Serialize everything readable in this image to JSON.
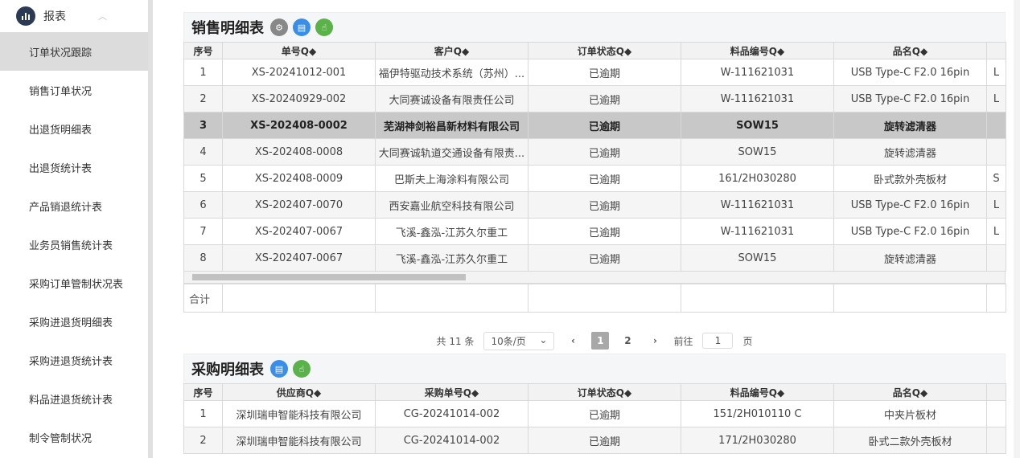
{
  "sidebar": {
    "header": {
      "label": "报表"
    },
    "items": [
      "订单状况跟踪",
      "销售订单状况",
      "出退货明细表",
      "出退货统计表",
      "产品销退统计表",
      "业务员销售统计表",
      "采购订单管制状况表",
      "采购进退货明细表",
      "采购进退货统计表",
      "料品进退货统计表",
      "制令管制状况"
    ],
    "active_index": 0
  },
  "sales": {
    "title": "销售明细表",
    "headers": [
      "序号",
      "单号Q◆",
      "客户Q◆",
      "订单状态Q◆",
      "料品编号Q◆",
      "品名Q◆"
    ],
    "rows": [
      [
        "1",
        "XS-20241012-001",
        "福伊特驱动技术系统（苏州）...",
        "已逾期",
        "W-111621031",
        "USB Type-C F2.0 16pin",
        "L"
      ],
      [
        "2",
        "XS-20240929-002",
        "大同赛诚设备有限责任公司",
        "已逾期",
        "W-111621031",
        "USB Type-C F2.0 16pin",
        "L"
      ],
      [
        "3",
        "XS-202408-0002",
        "芜湖神剑裕昌新材料有限公司",
        "已逾期",
        "SOW15",
        "旋转滤清器",
        ""
      ],
      [
        "4",
        "XS-202408-0008",
        "大同赛诚轨道交通设备有限责...",
        "已逾期",
        "SOW15",
        "旋转滤清器",
        ""
      ],
      [
        "5",
        "XS-202408-0009",
        "巴斯夫上海涂料有限公司",
        "已逾期",
        "161/2H030280",
        "卧式款外壳板材",
        "S"
      ],
      [
        "6",
        "XS-202407-0070",
        "西安嘉业航空科技有限公司",
        "已逾期",
        "W-111621031",
        "USB Type-C F2.0 16pin",
        "L"
      ],
      [
        "7",
        "XS-202407-0067",
        "飞溪-鑫泓-江苏久尔重工",
        "已逾期",
        "W-111621031",
        "USB Type-C F2.0 16pin",
        "L"
      ],
      [
        "8",
        "XS-202407-0067",
        "飞溪-鑫泓-江苏久尔重工",
        "已逾期",
        "SOW15",
        "旋转滤清器",
        ""
      ]
    ],
    "selected_row": 2,
    "total_label": "合计"
  },
  "pager": {
    "total": "共 11 条",
    "page_size": "10条/页",
    "prev": "‹",
    "pages": [
      "1",
      "2"
    ],
    "next": "›",
    "goto_prefix": "前往",
    "goto_value": "1",
    "goto_suffix": "页"
  },
  "purchase": {
    "title": "采购明细表",
    "headers": [
      "序号",
      "供应商Q◆",
      "采购单号Q◆",
      "订单状态Q◆",
      "料品编号Q◆",
      "品名Q◆"
    ],
    "rows": [
      [
        "1",
        "深圳瑞申智能科技有限公司",
        "CG-20241014-002",
        "已逾期",
        "151/2H010110 C",
        "中夹片板材",
        ""
      ],
      [
        "2",
        "深圳瑞申智能科技有限公司",
        "CG-20241014-002",
        "已逾期",
        "171/2H030280",
        "卧式二款外壳板材",
        ""
      ]
    ]
  }
}
